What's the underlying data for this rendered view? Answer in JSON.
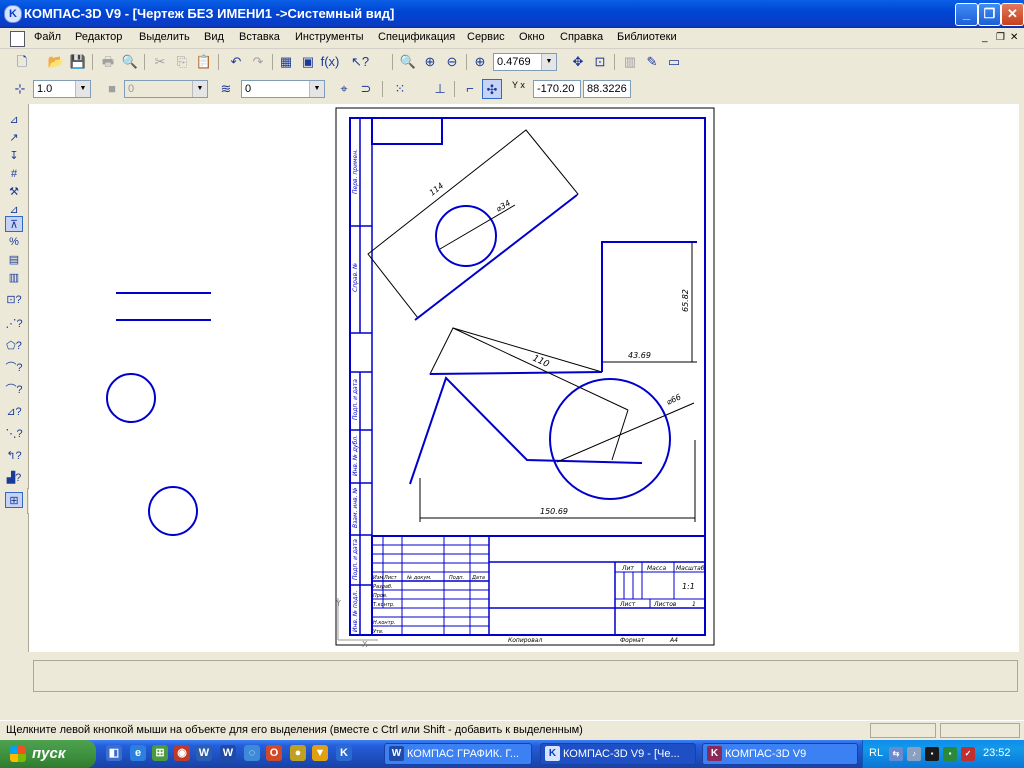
{
  "window": {
    "title": "КОМПАС-3D V9 - [Чертеж БЕЗ ИМЕНИ1 ->Системный вид]",
    "app_icon": "kompas-logo-icon",
    "controls": {
      "minimize": "_",
      "maximize": "❐",
      "close": "✕"
    }
  },
  "menu": {
    "items": [
      "Файл",
      "Редактор",
      "Выделить",
      "Вид",
      "Вставка",
      "Инструменты",
      "Спецификация",
      "Сервис",
      "Окно",
      "Справка",
      "Библиотеки"
    ],
    "mdi_controls": {
      "minimize": "_",
      "restore": "❐",
      "close": "✕"
    }
  },
  "toolbar": {
    "zoom_value": "0.4769",
    "line_width": "1.0",
    "style_value": "0",
    "layer_value": "0",
    "coord_x": "-170.20",
    "coord_y": "88.3226",
    "coord_label": "Y x"
  },
  "drawing": {
    "dim_rect_length": "114",
    "dim_circle_small": "⌀34",
    "dim_height": "65.82",
    "dim_step": "43.69",
    "dim_diag": "110",
    "dim_circle_big": "⌀66",
    "dim_width": "150.69",
    "stamp_lit": "Лит",
    "stamp_mass": "Масса",
    "stamp_scale": "Масштаб",
    "stamp_scale_value": "1:1",
    "stamp_sheet": "Лист",
    "stamp_sheets": "Листов",
    "stamp_sheets_value": "1",
    "stamp_change": "Изм",
    "stamp_list": "Лист",
    "stamp_docnum": "№ докум.",
    "stamp_sign": "Подп.",
    "stamp_date": "Дата",
    "stamp_dev": "Разраб.",
    "stamp_check": "Пров.",
    "stamp_tcontrol": "Т.контр.",
    "stamp_ncontrol": "Н.контр.",
    "stamp_approved": "Утв.",
    "footer_copy": "Копировал",
    "footer_format": "Формат",
    "footer_format_value": "A4",
    "side_perv": "Перв. примен.",
    "side_sprav": "Справ. №",
    "side_podp1": "Подп. и дата",
    "side_inv_dubl": "Инв. № дубл.",
    "side_vzam": "Взам. инв. №",
    "side_podp2": "Подп. и дата",
    "side_inv_podl": "Инв. № подл."
  },
  "status": {
    "message": "Щелкните левой кнопкой мыши на объекте для его выделения (вместе с Ctrl или Shift - добавить к выделенным)"
  },
  "taskbar": {
    "start": "пуск",
    "tasks": [
      "КОМПАС ГРАФИК. Г...",
      "КОМПАС-3D V9 - [Че...",
      "КОМПАС-3D V9"
    ],
    "lang": "RL",
    "clock": "23:52"
  }
}
